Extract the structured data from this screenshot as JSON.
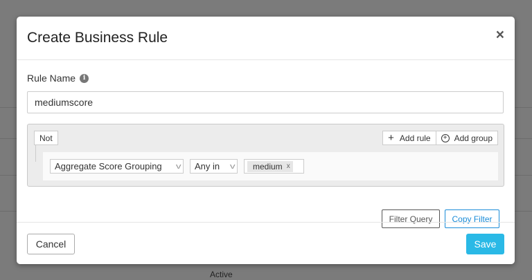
{
  "background": {
    "status_text": "Active"
  },
  "modal": {
    "title": "Create Business Rule",
    "close_label": "×"
  },
  "form": {
    "rule_name_label": "Rule Name",
    "info_icon": "i",
    "rule_name_value": "mediumscore"
  },
  "query_builder": {
    "not_label": "Not",
    "add_rule_label": "Add rule",
    "add_group_label": "Add group",
    "rule": {
      "field": "Aggregate Score Grouping",
      "operator": "Any in",
      "values": [
        "medium"
      ],
      "remove_tag_label": "x"
    }
  },
  "actions": {
    "filter_query_label": "Filter Query",
    "copy_filter_label": "Copy Filter"
  },
  "footer": {
    "cancel_label": "Cancel",
    "save_label": "Save"
  },
  "colors": {
    "primary": "#2ab9e6",
    "link_blue": "#1a8cd8",
    "overlay": "#7b7b7b"
  }
}
